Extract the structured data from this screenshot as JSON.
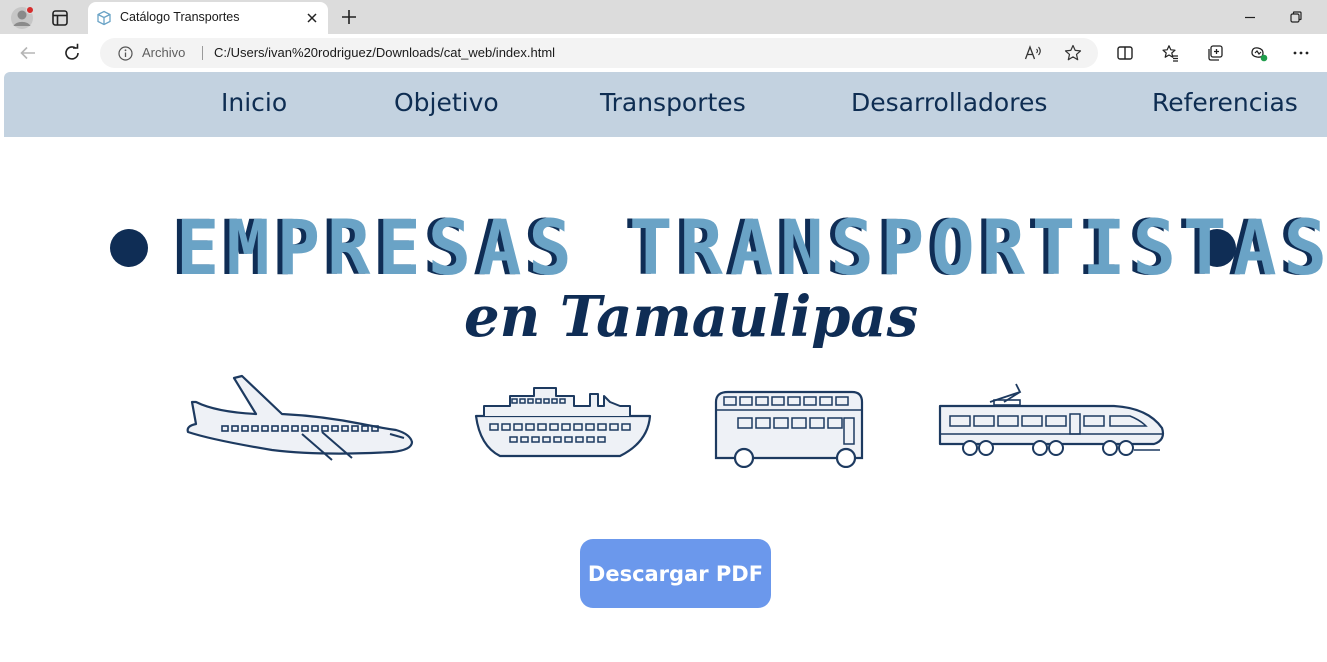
{
  "browser": {
    "tab_title": "Catálogo Transportes",
    "address_label": "Archivo",
    "address_url": "C:/Users/ivan%20rodriguez/Downloads/cat_web/index.html"
  },
  "nav": {
    "items": [
      {
        "label": "Inicio"
      },
      {
        "label": "Objetivo"
      },
      {
        "label": "Transportes"
      },
      {
        "label": "Desarrolladores"
      },
      {
        "label": "Referencias"
      }
    ]
  },
  "hero": {
    "title": "EMPRESAS TRANSPORTISTAS",
    "subtitle": "en Tamaulipas"
  },
  "cta": {
    "label": "Descargar PDF"
  },
  "colors": {
    "nav_bg": "#c3d2e0",
    "navy": "#0f2d55",
    "title_blue": "#6aa3c6",
    "button": "#6b98ec"
  },
  "icons": [
    "profile-icon",
    "tabs-icon",
    "favicon-icon",
    "close-icon",
    "plus-icon",
    "minimize-icon",
    "restore-icon",
    "back-icon",
    "reload-icon",
    "info-icon",
    "read-aloud-icon",
    "star-icon",
    "split-screen-icon",
    "favorites-icon",
    "collections-icon",
    "copilot-icon",
    "more-icon",
    "airplane-icon",
    "ship-icon",
    "bus-icon",
    "train-icon"
  ]
}
